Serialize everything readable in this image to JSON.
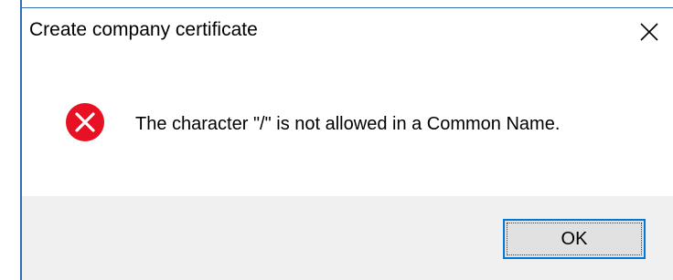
{
  "window": {
    "title": "Create company certificate",
    "close_icon": "close-icon"
  },
  "message": {
    "icon": "error-icon",
    "icon_color": "#e81123",
    "text": "The character \"/\" is not allowed in a Common Name."
  },
  "buttons": {
    "ok_label": "OK"
  },
  "colors": {
    "accent": "#0078d7",
    "footer_background": "#f0f0f0",
    "frame": "#2f6fb5"
  }
}
